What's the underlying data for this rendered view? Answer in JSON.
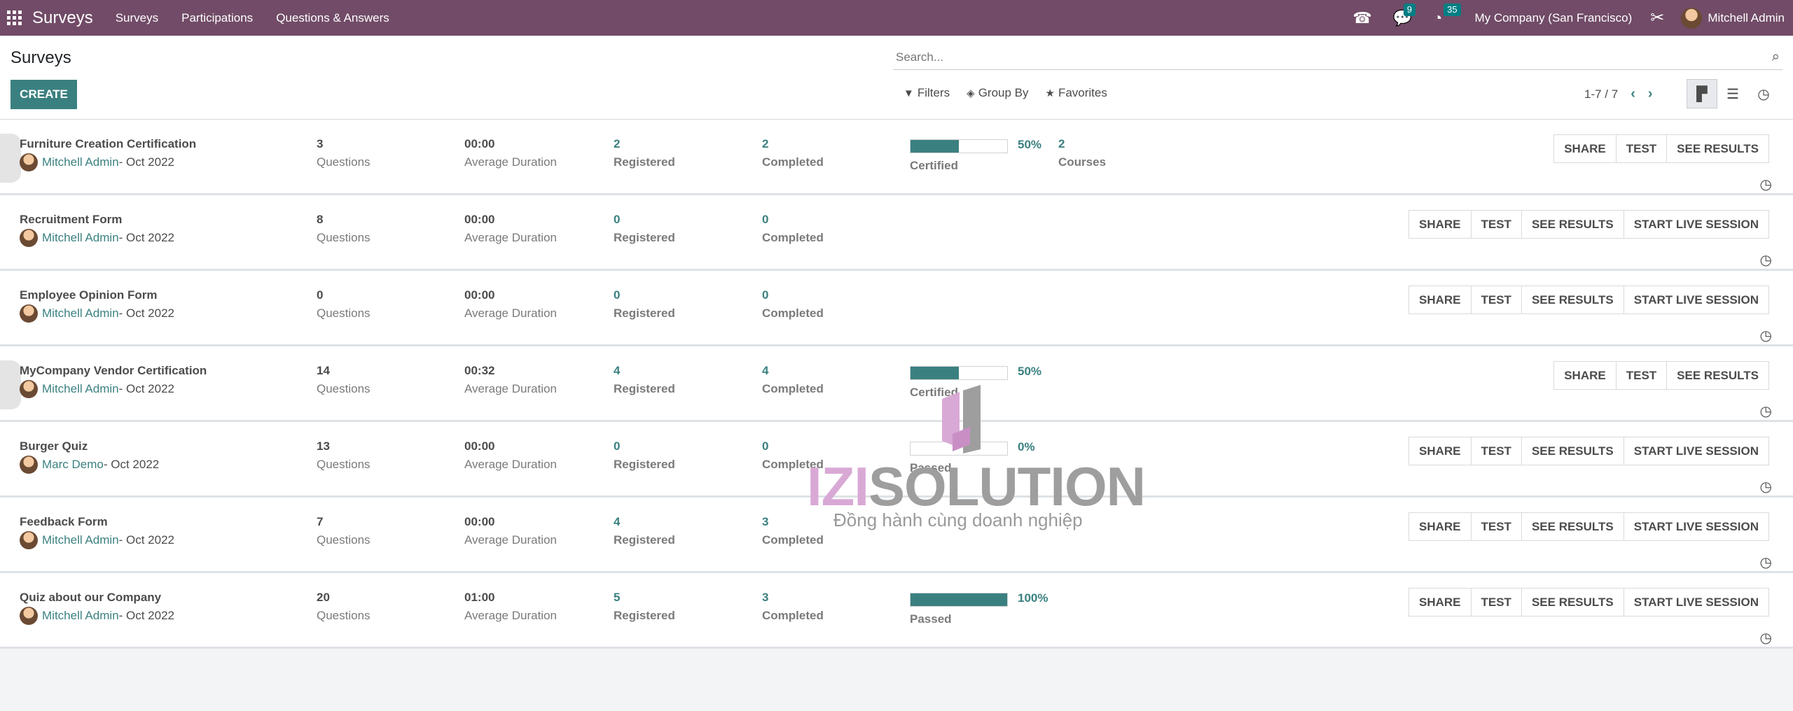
{
  "navbar": {
    "brand": "Surveys",
    "menu": [
      "Surveys",
      "Participations",
      "Questions & Answers"
    ],
    "messages_badge": "9",
    "activities_badge": "35",
    "company": "My Company (San Francisco)",
    "user": "Mitchell Admin"
  },
  "control_panel": {
    "title": "Surveys",
    "create_label": "CREATE",
    "search_placeholder": "Search...",
    "filters_label": "Filters",
    "group_by_label": "Group By",
    "favorites_label": "Favorites",
    "pager": "1-7 / 7"
  },
  "labels": {
    "questions": "Questions",
    "average_duration": "Average Duration",
    "registered": "Registered",
    "completed": "Completed",
    "courses": "Courses",
    "share": "SHARE",
    "test": "TEST",
    "see_results": "SEE RESULTS",
    "start_live_session": "START LIVE SESSION"
  },
  "surveys": [
    {
      "title": "Furniture Creation Certification",
      "author": "Mitchell Admin",
      "date": " - Oct 2022",
      "questions": "3",
      "duration": "00:00",
      "registered": "2",
      "completed": "2",
      "progress": 50,
      "progress_label": "50%",
      "result_label": "Certified",
      "courses": "2",
      "certification": true
    },
    {
      "title": "Recruitment Form",
      "author": "Mitchell Admin",
      "date": " - Oct 2022",
      "questions": "8",
      "duration": "00:00",
      "registered": "0",
      "completed": "0"
    },
    {
      "title": "Employee Opinion Form",
      "author": "Mitchell Admin",
      "date": " - Oct 2022",
      "questions": "0",
      "duration": "00:00",
      "registered": "0",
      "completed": "0"
    },
    {
      "title": "MyCompany Vendor Certification",
      "author": "Mitchell Admin",
      "date": " - Oct 2022",
      "questions": "14",
      "duration": "00:32",
      "registered": "4",
      "completed": "4",
      "progress": 50,
      "progress_label": "50%",
      "result_label": "Certified",
      "certification": true
    },
    {
      "title": "Burger Quiz",
      "author": "Marc Demo",
      "date": " - Oct 2022",
      "questions": "13",
      "duration": "00:00",
      "registered": "0",
      "completed": "0",
      "progress": 0,
      "progress_label": "0%",
      "result_label": "Passed"
    },
    {
      "title": "Feedback Form",
      "author": "Mitchell Admin",
      "date": " - Oct 2022",
      "questions": "7",
      "duration": "00:00",
      "registered": "4",
      "completed": "3"
    },
    {
      "title": "Quiz about our Company",
      "author": "Mitchell Admin",
      "date": " - Oct 2022",
      "questions": "20",
      "duration": "01:00",
      "registered": "5",
      "completed": "3",
      "progress": 100,
      "progress_label": "100%",
      "result_label": "Passed"
    }
  ],
  "watermark": {
    "brand_a": "IZI",
    "brand_b": "SOLUTION",
    "tagline": "Đồng hành cùng doanh nghiệp"
  },
  "colors": {
    "navbar": "#714b67",
    "accent": "#3b8080"
  }
}
